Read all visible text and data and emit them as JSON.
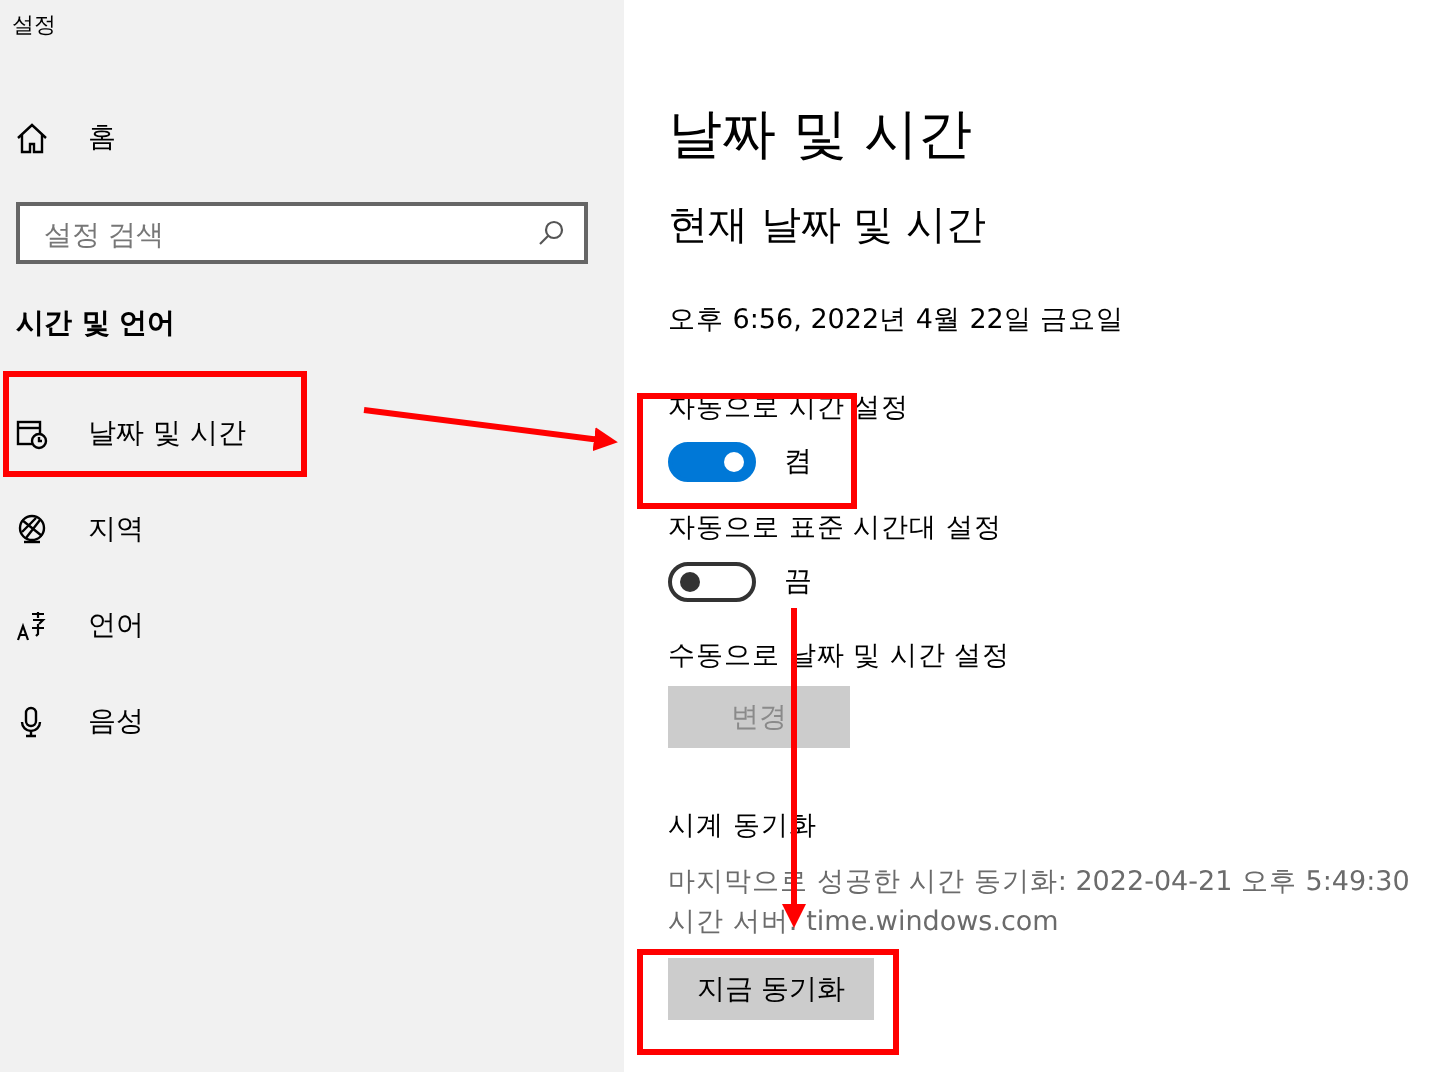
{
  "window": {
    "title": "설정"
  },
  "sidebar": {
    "home": "홈",
    "search": {
      "placeholder": "설정 검색"
    },
    "section": "시간 및 언어",
    "items": [
      {
        "kind": "calendar",
        "label": "날짜 및 시간"
      },
      {
        "kind": "globe",
        "label": "지역"
      },
      {
        "kind": "language",
        "label": "언어"
      },
      {
        "kind": "mic",
        "label": "음성"
      }
    ]
  },
  "main": {
    "title": "날짜 및 시간",
    "subtitle": "현재 날짜 및 시간",
    "current": "오후 6:56, 2022년 4월 22일 금요일",
    "toggles": [
      {
        "label": "자동으로 시간 설정",
        "on": true,
        "state": "켬"
      },
      {
        "label": "자동으로 표준 시간대 설정",
        "on": false,
        "state": "끔"
      }
    ],
    "manual": {
      "label": "수동으로 날짜 및 시간 설정",
      "button": "변경",
      "disabled": true
    },
    "sync": {
      "heading": "시계 동기화",
      "last": "마지막으로 성공한 시간 동기화: 2022-04-21 오후 5:49:30",
      "server": "시간 서버: time.windows.com",
      "button": "지금 동기화"
    }
  }
}
